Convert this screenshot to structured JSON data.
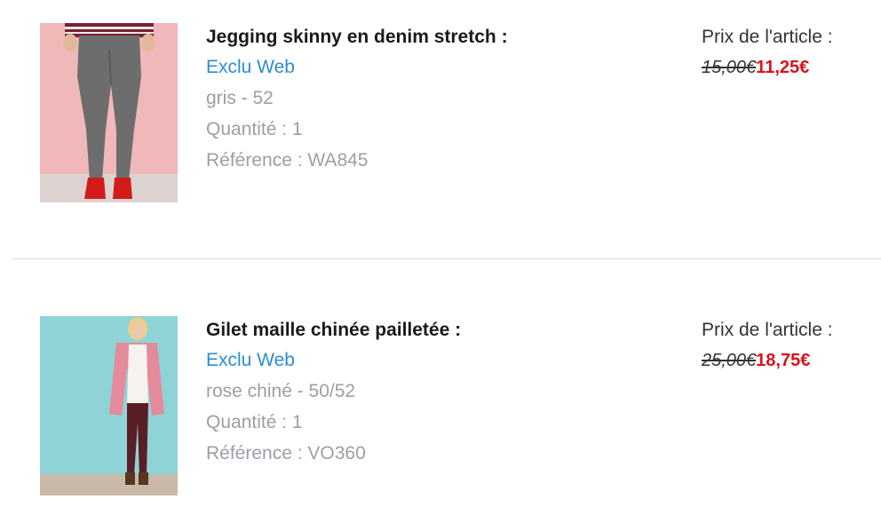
{
  "items": [
    {
      "title": "Jegging skinny en denim stretch :",
      "badge": "Exclu Web",
      "variant": "gris - 52",
      "quantity": "Quantité : 1",
      "reference": "Référence : WA845",
      "price_label": "Prix de l'article :",
      "old_price": "15,00€",
      "new_price": "11,25€",
      "image_alt": "product-photo-jegging"
    },
    {
      "title": "Gilet maille chinée pailletée :",
      "badge": "Exclu Web",
      "variant": "rose chiné - 50/52",
      "quantity": "Quantité : 1",
      "reference": "Référence : VO360",
      "price_label": "Prix de l'article :",
      "old_price": "25,00€",
      "new_price": "18,75€",
      "image_alt": "product-photo-gilet"
    }
  ],
  "colors": {
    "title": "#1a1a1a",
    "badge": "#2a8fcf",
    "meta": "#9aa0a6",
    "new_price": "#d5131b",
    "divider": "#d9d9d9"
  }
}
